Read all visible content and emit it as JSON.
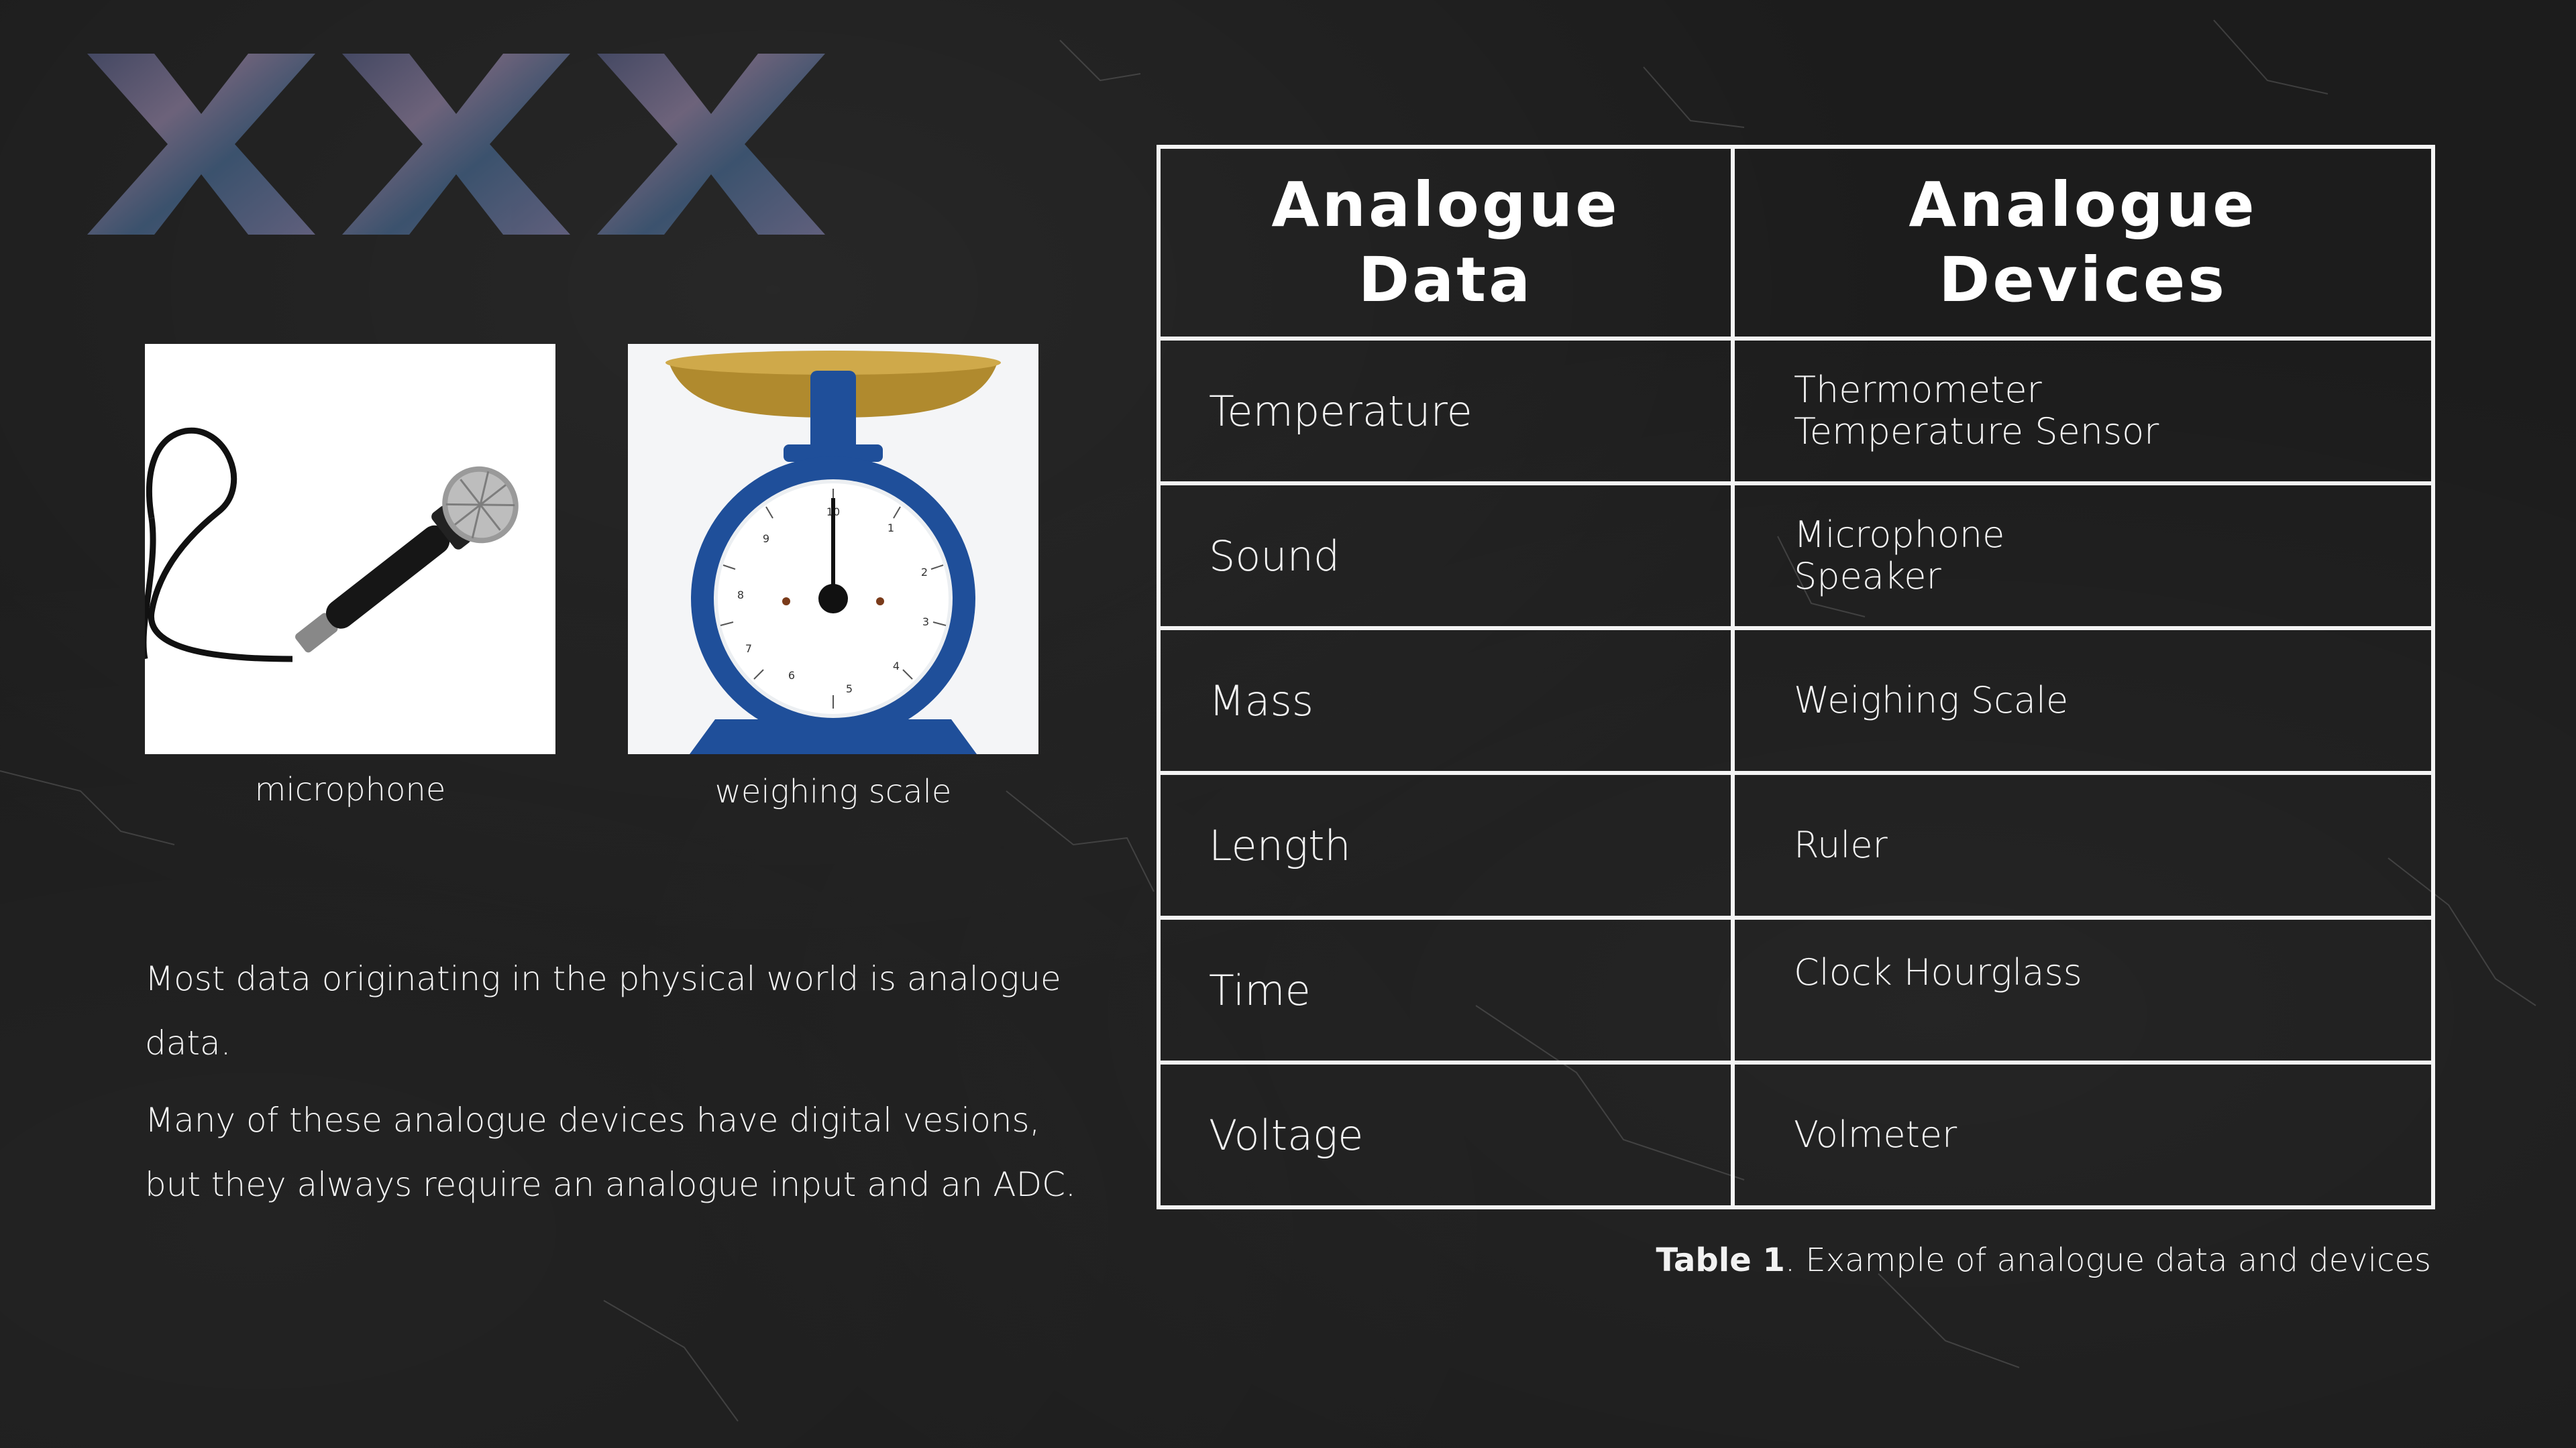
{
  "logo": {
    "text": "XXX"
  },
  "images": [
    {
      "name": "microphone",
      "caption": "microphone"
    },
    {
      "name": "weighing-scale",
      "caption": "weighing scale"
    }
  ],
  "scale_dial_numbers": [
    "10",
    "1",
    "2",
    "3",
    "4",
    "5",
    "6",
    "7",
    "8",
    "9"
  ],
  "paragraphs": [
    "Most data originating in the physical world is analogue data.",
    "Many of these analogue devices have digital vesions, but they always require an analogue input and an ADC."
  ],
  "table": {
    "headers": {
      "data": [
        "Analogue",
        "Data"
      ],
      "devices": [
        "Analogue",
        "Devices"
      ]
    },
    "rows": [
      {
        "data": "Temperature",
        "devices": [
          "Thermometer",
          "Temperature Sensor"
        ]
      },
      {
        "data": "Sound",
        "devices": [
          "Microphone",
          "Speaker"
        ]
      },
      {
        "data": "Mass",
        "devices": [
          "Weighing Scale"
        ]
      },
      {
        "data": "Length",
        "devices": [
          "Ruler"
        ]
      },
      {
        "data": "Time",
        "devices": [
          "Clock Hourglass"
        ]
      },
      {
        "data": "Voltage",
        "devices": [
          "Volmeter"
        ]
      }
    ],
    "caption": {
      "label": "Table 1",
      "text": ". Example of analogue data and devices"
    }
  },
  "colors": {
    "background": "#1c1c1c",
    "text": "#f4f4f4",
    "scale_blue": "#1f4f9a",
    "scale_pan": "#b08a2e"
  }
}
